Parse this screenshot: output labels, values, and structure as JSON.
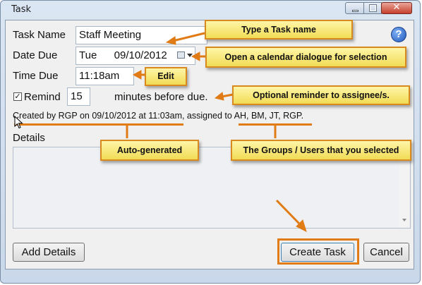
{
  "window": {
    "title": "Task"
  },
  "form": {
    "task_name_label": "Task Name",
    "task_name_value": "Staff Meeting",
    "date_due_label": "Date Due",
    "date_day": "Tue",
    "date_value": "09/10/2012",
    "time_due_label": "Time Due",
    "time_value": "11:18am",
    "remind_label": "Remind",
    "remind_checked": true,
    "remind_minutes": "15",
    "remind_suffix": "minutes before due.",
    "created_text": "Created by RGP on 09/10/2012 at 11:03am, assigned to",
    "assigned_to": "AH, BM, JT, RGP.",
    "details_label": "Details"
  },
  "buttons": {
    "add_details": "Add Details",
    "create_task": "Create Task",
    "cancel": "Cancel"
  },
  "callouts": {
    "task_name": "Type a Task name",
    "calendar": "Open a calendar dialogue for selection",
    "edit": "Edit",
    "reminder": "Optional reminder to assignee/s.",
    "auto": "Auto-generated",
    "groups": "The Groups / Users that you selected"
  },
  "colors": {
    "callout_fill": "#f5e46e",
    "callout_border": "#d98a1e",
    "annotation_orange": "#e07b15",
    "help_blue": "#2a66c9"
  }
}
